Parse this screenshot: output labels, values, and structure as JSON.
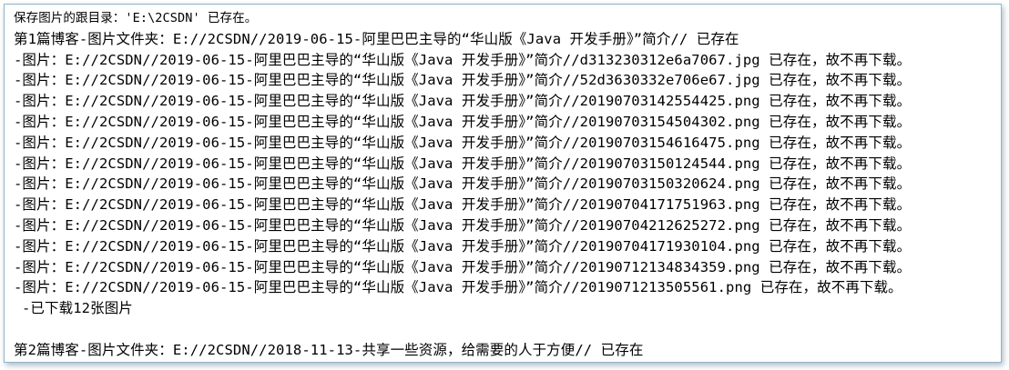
{
  "console": {
    "lines": [
      "保存图片的跟目录：'E:\\2CSDN' 已存在。",
      "第1篇博客-图片文件夹：E://2CSDN//2019-06-15-阿里巴巴主导的“华山版《Java 开发手册》”简介// 已存在",
      "-图片：E://2CSDN//2019-06-15-阿里巴巴主导的“华山版《Java 开发手册》”简介//d313230312e6a7067.jpg 已存在，故不再下载。",
      "-图片：E://2CSDN//2019-06-15-阿里巴巴主导的“华山版《Java 开发手册》”简介//52d3630332e706e67.jpg 已存在，故不再下载。",
      "-图片：E://2CSDN//2019-06-15-阿里巴巴主导的“华山版《Java 开发手册》”简介//20190703142554425.png 已存在，故不再下载。",
      "-图片：E://2CSDN//2019-06-15-阿里巴巴主导的“华山版《Java 开发手册》”简介//20190703154504302.png 已存在，故不再下载。",
      "-图片：E://2CSDN//2019-06-15-阿里巴巴主导的“华山版《Java 开发手册》”简介//20190703154616475.png 已存在，故不再下载。",
      "-图片：E://2CSDN//2019-06-15-阿里巴巴主导的“华山版《Java 开发手册》”简介//20190703150124544.png 已存在，故不再下载。",
      "-图片：E://2CSDN//2019-06-15-阿里巴巴主导的“华山版《Java 开发手册》”简介//20190703150320624.png 已存在，故不再下载。",
      "-图片：E://2CSDN//2019-06-15-阿里巴巴主导的“华山版《Java 开发手册》”简介//20190704171751963.png 已存在，故不再下载。",
      "-图片：E://2CSDN//2019-06-15-阿里巴巴主导的“华山版《Java 开发手册》”简介//20190704212625272.png 已存在，故不再下载。",
      "-图片：E://2CSDN//2019-06-15-阿里巴巴主导的“华山版《Java 开发手册》”简介//20190704171930104.png 已存在，故不再下载。",
      "-图片：E://2CSDN//2019-06-15-阿里巴巴主导的“华山版《Java 开发手册》”简介//20190712134834359.png 已存在，故不再下载。",
      "-图片：E://2CSDN//2019-06-15-阿里巴巴主导的“华山版《Java 开发手册》”简介//2019071213505561.png 已存在，故不再下载。",
      "-已下载12张图片",
      "",
      "第2篇博客-图片文件夹：E://2CSDN//2018-11-13-共享一些资源，给需要的人于方便// 已存在"
    ]
  }
}
